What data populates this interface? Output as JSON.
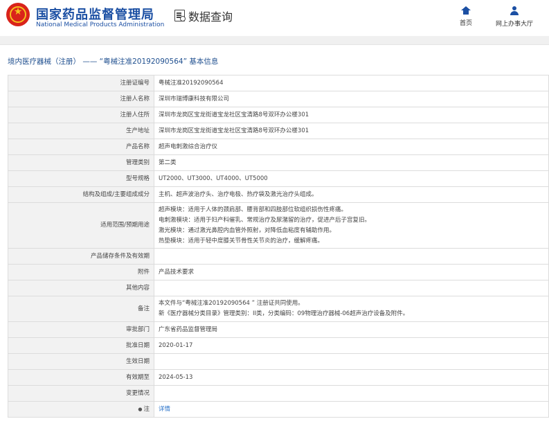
{
  "header": {
    "brand_cn": "国家药品监督管理局",
    "brand_en": "National Medical Products Administration",
    "query_label": "数据查询",
    "nav": [
      {
        "label": "首页",
        "icon": "home-icon"
      },
      {
        "label": "网上办事大厅",
        "icon": "user-icon"
      }
    ]
  },
  "page": {
    "heading": "境内医疗器械（注册） —— “粤械注准20192090564” 基本信息"
  },
  "rows": [
    {
      "label": "注册证编号",
      "value": "粤械注准20192090564"
    },
    {
      "label": "注册人名称",
      "value": "深圳市瑞博康科技有限公司"
    },
    {
      "label": "注册人住所",
      "value": "深圳市龙岗区宝龙街道宝龙社区宝清路8号双环办公楼301"
    },
    {
      "label": "生产地址",
      "value": "深圳市龙岗区宝龙街道宝龙社区宝清路8号双环办公楼301"
    },
    {
      "label": "产品名称",
      "value": "超声电刺激综合治疗仪"
    },
    {
      "label": "管理类别",
      "value": "第二类"
    },
    {
      "label": "型号规格",
      "value": "UT2000、UT3000、UT4000、UT5000"
    },
    {
      "label": "结构及组成/主要组成成分",
      "value": "主机、超声波治疗头、治疗电极、热疗袋及激光治疗头组成。"
    },
    {
      "label": "适用范围/预期用途",
      "lines": [
        "超声模块：适用于人体的颈肩部、腰背部和四肢部位软组织损伤性疼痛。",
        "电刺激模块：适用于妇产科催乳、常规治疗及尿潴留的治疗，促进产后子宫复旧。",
        "激光模块：通过激光鼻腔内血管外照射，对降低血粘度有辅助作用。",
        "热垫模块：适用于轻中度膝关节骨性关节炎的治疗，缓解疼痛。"
      ]
    },
    {
      "label": "产品储存条件及有效期",
      "value": ""
    },
    {
      "label": "附件",
      "value": "产品技术要求"
    },
    {
      "label": "其他内容",
      "value": ""
    },
    {
      "label": "备注",
      "lines": [
        "本文件与“粤械注准20192090564 ” 注册证共同使用。",
        "新《医疗器械分类目录》管理类别：II类，分类编码：09物理治疗器械-06超声治疗设备及附件。"
      ]
    },
    {
      "label": "审批部门",
      "value": "广东省药品监督管理局"
    },
    {
      "label": "批准日期",
      "value": "2020-01-17"
    },
    {
      "label": "生效日期",
      "value": ""
    },
    {
      "label": "有效期至",
      "value": "2024-05-13"
    },
    {
      "label": "变更情况",
      "value": ""
    },
    {
      "label": "注",
      "value": "详情",
      "link": true,
      "icon": "pin-icon"
    }
  ]
}
